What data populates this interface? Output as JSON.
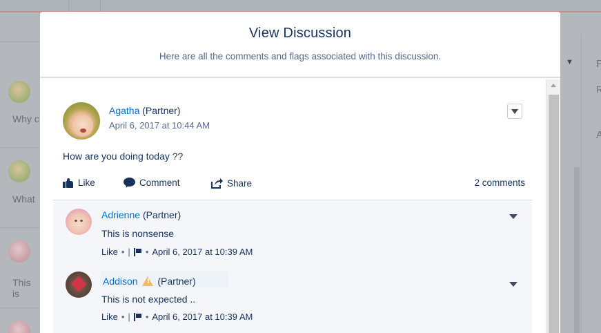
{
  "modal": {
    "title": "View Discussion",
    "subtitle": "Here are all the comments and flags associated with this discussion."
  },
  "post": {
    "author": "Agatha",
    "role": "(Partner)",
    "date": "April 6, 2017 at 10:44 AM",
    "text": "How are you doing today ??",
    "actions": {
      "like": "Like",
      "comment": "Comment",
      "share": "Share"
    },
    "comments_count": "2 comments"
  },
  "comments": [
    {
      "author": "Adrienne",
      "role": "(Partner)",
      "text": "This is nonsense",
      "like": "Like",
      "date": "April 6, 2017 at 10:39 AM",
      "warning": false
    },
    {
      "author": "Addison",
      "role": "(Partner)",
      "text": "This is not expected ..",
      "like": "Like",
      "date": "April 6, 2017 at 10:39 AM",
      "warning": true
    }
  ],
  "background": {
    "left_snippets": [
      "Why c",
      "What",
      "This is"
    ],
    "right_letters": [
      "P",
      "R",
      "A"
    ]
  }
}
